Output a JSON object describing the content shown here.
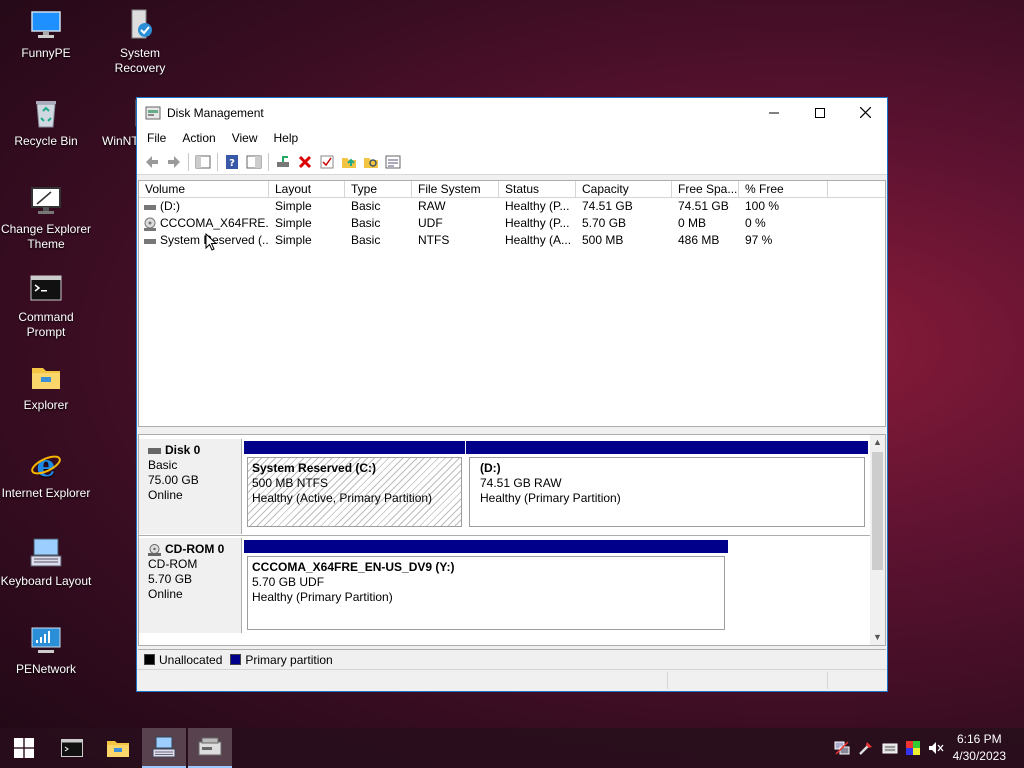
{
  "desktop": {
    "icons": [
      {
        "label": "FunnyPE",
        "icon": "monitor-icon"
      },
      {
        "label": "System Recovery",
        "icon": "recovery-icon"
      },
      {
        "label": "Recycle Bin",
        "icon": "recycle-bin-icon"
      },
      {
        "label": "WinNT",
        "icon": "winnt-icon"
      },
      {
        "label": "Change Explorer Theme",
        "icon": "monitor-icon"
      },
      {
        "label": "Command Prompt",
        "icon": "terminal-icon"
      },
      {
        "label": "Explorer",
        "icon": "folder-icon"
      },
      {
        "label": "Internet Explorer",
        "icon": "ie-icon"
      },
      {
        "label": "Keyboard Layout",
        "icon": "keyboard-icon"
      },
      {
        "label": "PENetwork",
        "icon": "network-icon"
      }
    ]
  },
  "window": {
    "title": "Disk Management",
    "menu": [
      "File",
      "Action",
      "View",
      "Help"
    ]
  },
  "list": {
    "columns": [
      "Volume",
      "Layout",
      "Type",
      "File System",
      "Status",
      "Capacity",
      "Free Spa...",
      "% Free"
    ],
    "rows": [
      [
        "(D:)",
        "Simple",
        "Basic",
        "RAW",
        "Healthy (P...",
        "74.51 GB",
        "74.51 GB",
        "100 %"
      ],
      [
        "CCCOMA_X64FRE...",
        "Simple",
        "Basic",
        "UDF",
        "Healthy (P...",
        "5.70 GB",
        "0 MB",
        "0 %"
      ],
      [
        "System Reserved (...",
        "Simple",
        "Basic",
        "NTFS",
        "Healthy (A...",
        "500 MB",
        "486 MB",
        "97 %"
      ]
    ]
  },
  "disks": [
    {
      "name": "Disk 0",
      "type": "Basic",
      "size": "75.00 GB",
      "state": "Online",
      "partitions": [
        {
          "name": "System Reserved  (C:)",
          "fs": "500 MB NTFS",
          "status": "Healthy (Active, Primary Partition)"
        },
        {
          "name": "(D:)",
          "fs": "74.51 GB RAW",
          "status": "Healthy (Primary Partition)"
        }
      ]
    },
    {
      "name": "CD-ROM 0",
      "type": "CD-ROM",
      "size": "5.70 GB",
      "state": "Online",
      "partitions": [
        {
          "name": "CCCOMA_X64FRE_EN-US_DV9  (Y:)",
          "fs": "5.70 GB UDF",
          "status": "Healthy (Primary Partition)"
        }
      ]
    }
  ],
  "legend": {
    "unallocated": "Unallocated",
    "primary": "Primary partition"
  },
  "colors": {
    "primary_partition": "#00008b",
    "unallocated": "#000000",
    "title_border": "#1c74c8"
  },
  "taskbar": {
    "time": "6:16 PM",
    "date": "4/30/2023"
  }
}
